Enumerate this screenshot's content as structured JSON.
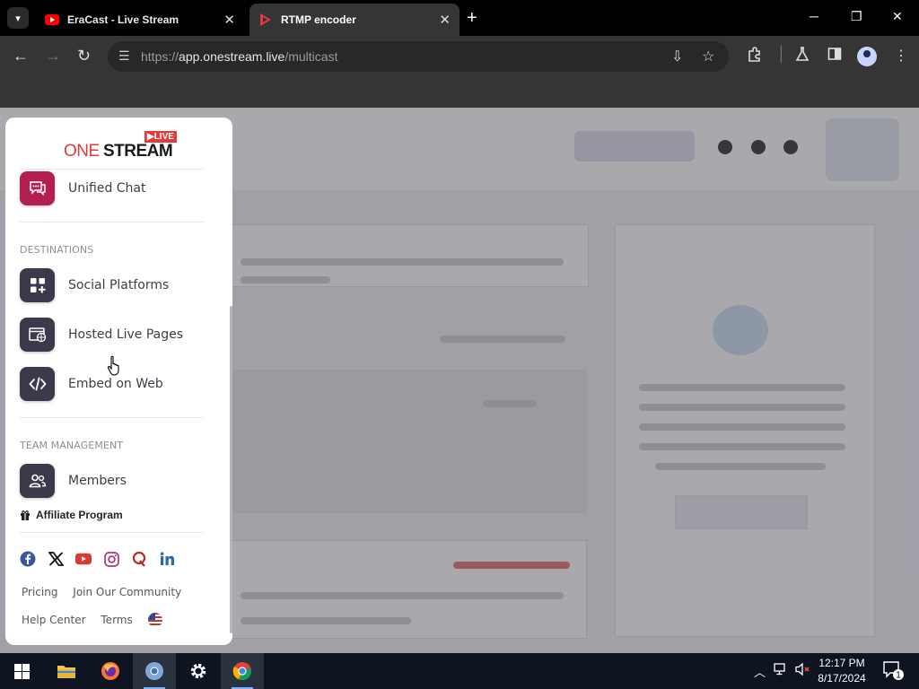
{
  "browser": {
    "tabs": [
      {
        "title": "EraCast - Live Stream",
        "active": false
      },
      {
        "title": "RTMP encoder",
        "active": true
      }
    ],
    "url_prefix": "https://",
    "url_host": "app.onestream.live",
    "url_path": "/multicast"
  },
  "sidemenu": {
    "logo": {
      "one": "ONE",
      "stream": "STREAM",
      "badge": "▶LIVE"
    },
    "unified_chat": "Unified Chat",
    "destinations_title": "DESTINATIONS",
    "social_platforms": "Social Platforms",
    "hosted_live_pages": "Hosted Live Pages",
    "embed_on_web": "Embed on Web",
    "team_title": "TEAM MANAGEMENT",
    "members": "Members",
    "affiliate": "Affiliate Program",
    "footer_links": {
      "pricing": "Pricing",
      "community": "Join Our Community",
      "help": "Help Center",
      "terms": "Terms"
    }
  },
  "taskbar": {
    "time": "12:17 PM",
    "date": "8/17/2024",
    "notifications": "1"
  },
  "colors": {
    "menu_icon_bg": "#3b3a4a",
    "chat_icon_bg": "#b3204f",
    "brand_red": "#e23b3b"
  }
}
